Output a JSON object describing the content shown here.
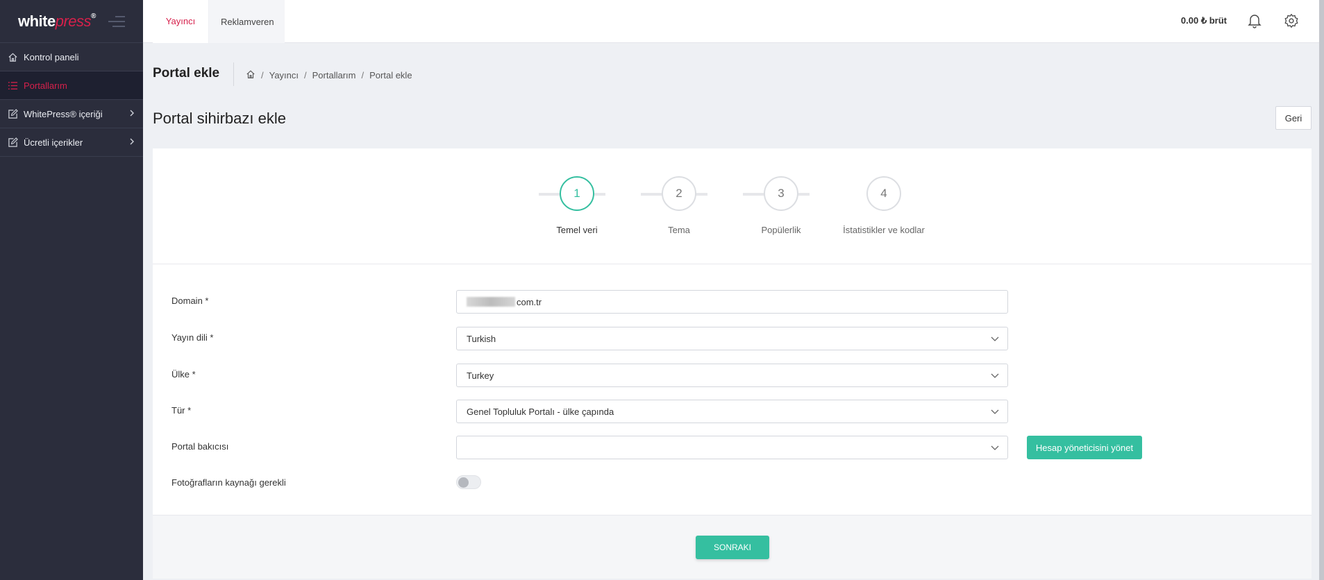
{
  "logo": {
    "main": "white",
    "accent": "press",
    "reg": "®"
  },
  "sidebar": {
    "items": [
      {
        "label": "Kontrol paneli",
        "icon": "home-icon"
      },
      {
        "label": "Portallarım",
        "icon": "list-icon",
        "active": true
      },
      {
        "label": "WhitePress® içeriği",
        "icon": "edit-icon",
        "has_submenu": true
      },
      {
        "label": "Ücretli içerikler",
        "icon": "edit-icon",
        "has_submenu": true
      }
    ]
  },
  "topbar": {
    "tabs": [
      {
        "label": "Yayıncı",
        "active": true
      },
      {
        "label": "Reklamveren",
        "active": false
      }
    ],
    "balance": "0.00 ₺ brüt"
  },
  "page": {
    "title": "Portal ekle",
    "breadcrumb": [
      "Yayıncı",
      "Portallarım",
      "Portal ekle"
    ],
    "breadcrumb_sep": "/",
    "wizard_title": "Portal sihirbazı ekle",
    "back_label": "Geri"
  },
  "steps": [
    {
      "number": "1",
      "label": "Temel veri",
      "active": true
    },
    {
      "number": "2",
      "label": "Tema",
      "active": false
    },
    {
      "number": "3",
      "label": "Popülerlik",
      "active": false
    },
    {
      "number": "4",
      "label": "İstatistikler ve kodlar",
      "active": false
    }
  ],
  "form": {
    "domain_label": "Domain *",
    "domain_value": "com.tr",
    "language_label": "Yayın dili *",
    "language_value": "Turkish",
    "country_label": "Ülke *",
    "country_value": "Turkey",
    "type_label": "Tür *",
    "type_value": "Genel Topluluk Portalı - ülke çapında",
    "manager_label": "Portal bakıcısı",
    "manager_value": "",
    "manage_button": "Hesap yöneticisini yönet",
    "photo_source_label": "Fotoğrafların kaynağı gerekli",
    "photo_source_enabled": false
  },
  "next_button": "SONRAKI",
  "colors": {
    "accent": "#35bfa0",
    "brand": "#d6204b",
    "sidebar": "#2b2d3c"
  }
}
